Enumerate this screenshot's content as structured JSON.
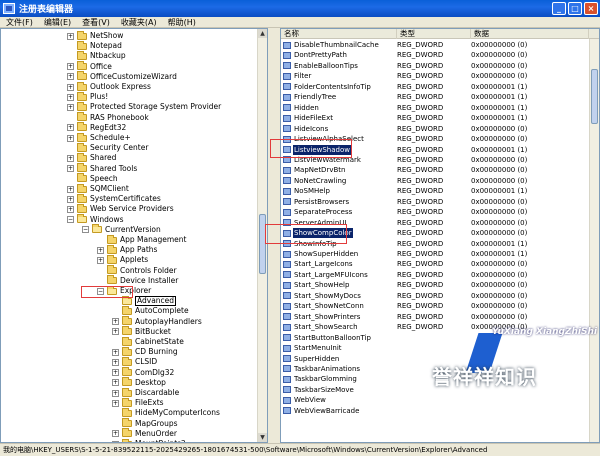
{
  "window": {
    "title": "注册表编辑器",
    "minimize": "_",
    "maximize": "□",
    "close": "×"
  },
  "menu": [
    {
      "label": "文件(F)"
    },
    {
      "label": "编辑(E)"
    },
    {
      "label": "查看(V)"
    },
    {
      "label": "收藏夹(A)"
    },
    {
      "label": "帮助(H)"
    }
  ],
  "tree": {
    "items": [
      {
        "label": "NetShow",
        "level": 0,
        "expander": "+"
      },
      {
        "label": "Notepad",
        "level": 0,
        "expander": ""
      },
      {
        "label": "Ntbackup",
        "level": 0,
        "expander": ""
      },
      {
        "label": "Office",
        "level": 0,
        "expander": "+"
      },
      {
        "label": "OfficeCustomizeWizard",
        "level": 0,
        "expander": "+"
      },
      {
        "label": "Outlook Express",
        "level": 0,
        "expander": "+"
      },
      {
        "label": "Plus!",
        "level": 0,
        "expander": "+"
      },
      {
        "label": "Protected Storage System Provider",
        "level": 0,
        "expander": "+"
      },
      {
        "label": "RAS Phonebook",
        "level": 0,
        "expander": ""
      },
      {
        "label": "RegEdt32",
        "level": 0,
        "expander": "+"
      },
      {
        "label": "Schedule+",
        "level": 0,
        "expander": "+"
      },
      {
        "label": "Security Center",
        "level": 0,
        "expander": ""
      },
      {
        "label": "Shared",
        "level": 0,
        "expander": "+"
      },
      {
        "label": "Shared Tools",
        "level": 0,
        "expander": "+"
      },
      {
        "label": "Speech",
        "level": 0,
        "expander": ""
      },
      {
        "label": "SQMClient",
        "level": 0,
        "expander": "+"
      },
      {
        "label": "SystemCertificates",
        "level": 0,
        "expander": "+"
      },
      {
        "label": "Web Service Providers",
        "level": 0,
        "expander": "+"
      },
      {
        "label": "Windows",
        "level": 0,
        "expander": "−",
        "open": true
      },
      {
        "label": "CurrentVersion",
        "level": 1,
        "expander": "−",
        "open": true
      },
      {
        "label": "App Management",
        "level": 2,
        "expander": ""
      },
      {
        "label": "App Paths",
        "level": 2,
        "expander": "+"
      },
      {
        "label": "Applets",
        "level": 2,
        "expander": "+"
      },
      {
        "label": "Controls Folder",
        "level": 2,
        "expander": ""
      },
      {
        "label": "Device Installer",
        "level": 2,
        "expander": ""
      },
      {
        "label": "Explorer",
        "level": 2,
        "expander": "−",
        "open": true
      },
      {
        "label": "Advanced",
        "level": 3,
        "expander": "",
        "selected": true,
        "open": true
      },
      {
        "label": "AutoComplete",
        "level": 3,
        "expander": ""
      },
      {
        "label": "AutoplayHandlers",
        "level": 3,
        "expander": "+"
      },
      {
        "label": "BitBucket",
        "level": 3,
        "expander": "+"
      },
      {
        "label": "CabinetState",
        "level": 3,
        "expander": ""
      },
      {
        "label": "CD Burning",
        "level": 3,
        "expander": "+"
      },
      {
        "label": "CLSID",
        "level": 3,
        "expander": "+"
      },
      {
        "label": "ComDlg32",
        "level": 3,
        "expander": "+"
      },
      {
        "label": "Desktop",
        "level": 3,
        "expander": "+"
      },
      {
        "label": "Discardable",
        "level": 3,
        "expander": "+"
      },
      {
        "label": "FileExts",
        "level": 3,
        "expander": "+"
      },
      {
        "label": "HideMyComputerIcons",
        "level": 3,
        "expander": ""
      },
      {
        "label": "MapGroups",
        "level": 3,
        "expander": ""
      },
      {
        "label": "MenuOrder",
        "level": 3,
        "expander": "+"
      },
      {
        "label": "MountPoints2",
        "level": 3,
        "expander": "+"
      }
    ]
  },
  "list": {
    "columns": {
      "name": "名称",
      "type": "类型",
      "data": "数据"
    },
    "rows": [
      {
        "name": "DisableThumbnailCache",
        "type": "REG_DWORD",
        "data": "0x00000000 (0)"
      },
      {
        "name": "DontPrettyPath",
        "type": "REG_DWORD",
        "data": "0x00000000 (0)"
      },
      {
        "name": "EnableBalloonTips",
        "type": "REG_DWORD",
        "data": "0x00000000 (0)"
      },
      {
        "name": "Filter",
        "type": "REG_DWORD",
        "data": "0x00000000 (0)"
      },
      {
        "name": "FolderContentsInfoTip",
        "type": "REG_DWORD",
        "data": "0x00000001 (1)"
      },
      {
        "name": "FriendlyTree",
        "type": "REG_DWORD",
        "data": "0x00000001 (1)"
      },
      {
        "name": "Hidden",
        "type": "REG_DWORD",
        "data": "0x00000001 (1)"
      },
      {
        "name": "HideFileExt",
        "type": "REG_DWORD",
        "data": "0x00000001 (1)"
      },
      {
        "name": "HideIcons",
        "type": "REG_DWORD",
        "data": "0x00000000 (0)"
      },
      {
        "name": "ListviewAlphaSelect",
        "type": "REG_DWORD",
        "data": "0x00000000 (0)"
      },
      {
        "name": "ListviewShadow",
        "type": "REG_DWORD",
        "data": "0x00000001 (1)",
        "selected": true
      },
      {
        "name": "ListviewWatermark",
        "type": "REG_DWORD",
        "data": "0x00000000 (0)"
      },
      {
        "name": "MapNetDrvBtn",
        "type": "REG_DWORD",
        "data": "0x00000000 (0)"
      },
      {
        "name": "NoNetCrawling",
        "type": "REG_DWORD",
        "data": "0x00000000 (0)"
      },
      {
        "name": "NoSMHelp",
        "type": "REG_DWORD",
        "data": "0x00000001 (1)"
      },
      {
        "name": "PersistBrowsers",
        "type": "REG_DWORD",
        "data": "0x00000000 (0)"
      },
      {
        "name": "SeparateProcess",
        "type": "REG_DWORD",
        "data": "0x00000000 (0)"
      },
      {
        "name": "ServerAdminUI",
        "type": "REG_DWORD",
        "data": "0x00000000 (0)"
      },
      {
        "name": "ShowCompColor",
        "type": "REG_DWORD",
        "data": "0x00000000 (0)",
        "selected": true
      },
      {
        "name": "ShowInfoTip",
        "type": "REG_DWORD",
        "data": "0x00000001 (1)"
      },
      {
        "name": "ShowSuperHidden",
        "type": "REG_DWORD",
        "data": "0x00000001 (1)"
      },
      {
        "name": "Start_LargeIcons",
        "type": "REG_DWORD",
        "data": "0x00000000 (0)"
      },
      {
        "name": "Start_LargeMFUIcons",
        "type": "REG_DWORD",
        "data": "0x00000000 (0)"
      },
      {
        "name": "Start_ShowHelp",
        "type": "REG_DWORD",
        "data": "0x00000000 (0)"
      },
      {
        "name": "Start_ShowMyDocs",
        "type": "REG_DWORD",
        "data": "0x00000000 (0)"
      },
      {
        "name": "Start_ShowNetConn",
        "type": "REG_DWORD",
        "data": "0x00000000 (0)"
      },
      {
        "name": "Start_ShowPrinters",
        "type": "REG_DWORD",
        "data": "0x00000000 (0)"
      },
      {
        "name": "Start_ShowSearch",
        "type": "REG_DWORD",
        "data": "0x00000000 (0)"
      },
      {
        "name": "StartButtonBalloonTip",
        "type": "",
        "data": ""
      },
      {
        "name": "StartMenuInit",
        "type": "",
        "data": ""
      },
      {
        "name": "SuperHidden",
        "type": "",
        "data": ""
      },
      {
        "name": "TaskbarAnimations",
        "type": "",
        "data": ""
      },
      {
        "name": "TaskbarGlomming",
        "type": "",
        "data": ""
      },
      {
        "name": "TaskbarSizeMove",
        "type": "",
        "data": ""
      },
      {
        "name": "WebView",
        "type": "",
        "data": ""
      },
      {
        "name": "WebViewBarricade",
        "type": "",
        "data": ""
      }
    ]
  },
  "statusbar": {
    "path": "我的电脑\\HKEY_USERS\\S-1-5-21-839522115-2025429265-1801674531-500\\Software\\Microsoft\\Windows\\CurrentVersion\\Explorer\\Advanced"
  },
  "watermark": {
    "latin": "YuXiang XiangZhiShi",
    "chinese": "誉祥祥知识"
  },
  "colors": {
    "titlebar": "#0a5fd8",
    "selection": "#0a246a",
    "annotation": "#e23b3b",
    "folder": "#f4d46a"
  }
}
